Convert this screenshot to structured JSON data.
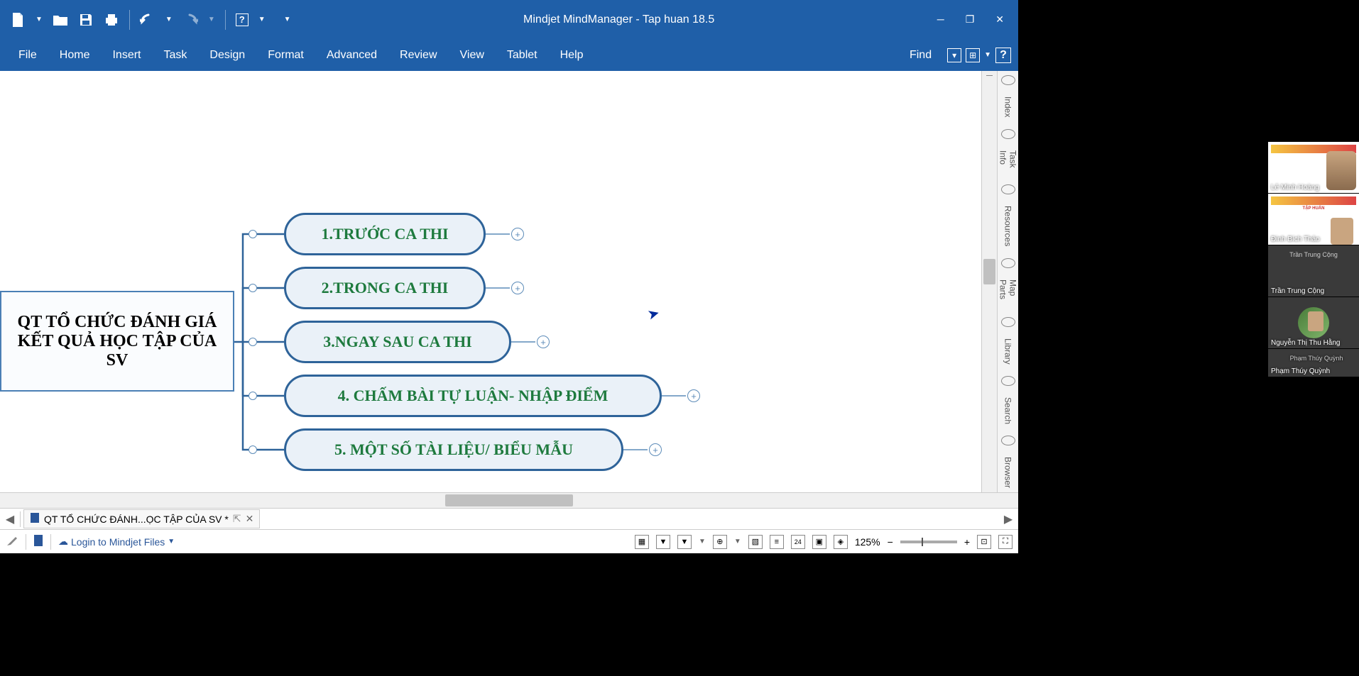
{
  "app": {
    "title": "Mindjet MindManager - Tap huan 18.5"
  },
  "menu": {
    "file": "File",
    "home": "Home",
    "insert": "Insert",
    "task": "Task",
    "design": "Design",
    "format": "Format",
    "advanced": "Advanced",
    "review": "Review",
    "view": "View",
    "tablet": "Tablet",
    "help": "Help",
    "find": "Find"
  },
  "mindmap": {
    "central": "QT TỔ CHỨC ĐÁNH GIÁ KẾT QUẢ HỌC TẬP CỦA SV",
    "branches": [
      "1.TRƯỚC CA THI",
      "2.TRONG CA THI",
      "3.NGAY SAU CA THI",
      "4. CHẤM BÀI TỰ LUẬN- NHẬP ĐIỂM",
      "5. MỘT SỐ TÀI LIỆU/ BIỂU MẪU"
    ]
  },
  "side_tabs": {
    "index": "Index",
    "task_info": "Task Info",
    "resources": "Resources",
    "map_parts": "Map Parts",
    "library": "Library",
    "search": "Search",
    "browser": "Browser"
  },
  "tab": {
    "name": "QT TỔ CHỨC ĐÁNH...ỌC TẬP CỦA SV *"
  },
  "status": {
    "login": "Login to Mindjet Files",
    "zoom": "125%"
  },
  "participants": [
    "Lê Minh Hoàng",
    "Đinh Bích Thảo",
    "Trần Trung Cộng",
    "Trần Trung Cộng",
    "Nguyễn Thị Thu Hằng",
    "Phạm Thúy Quỳnh",
    "Phạm Thúy Quỳnh"
  ]
}
